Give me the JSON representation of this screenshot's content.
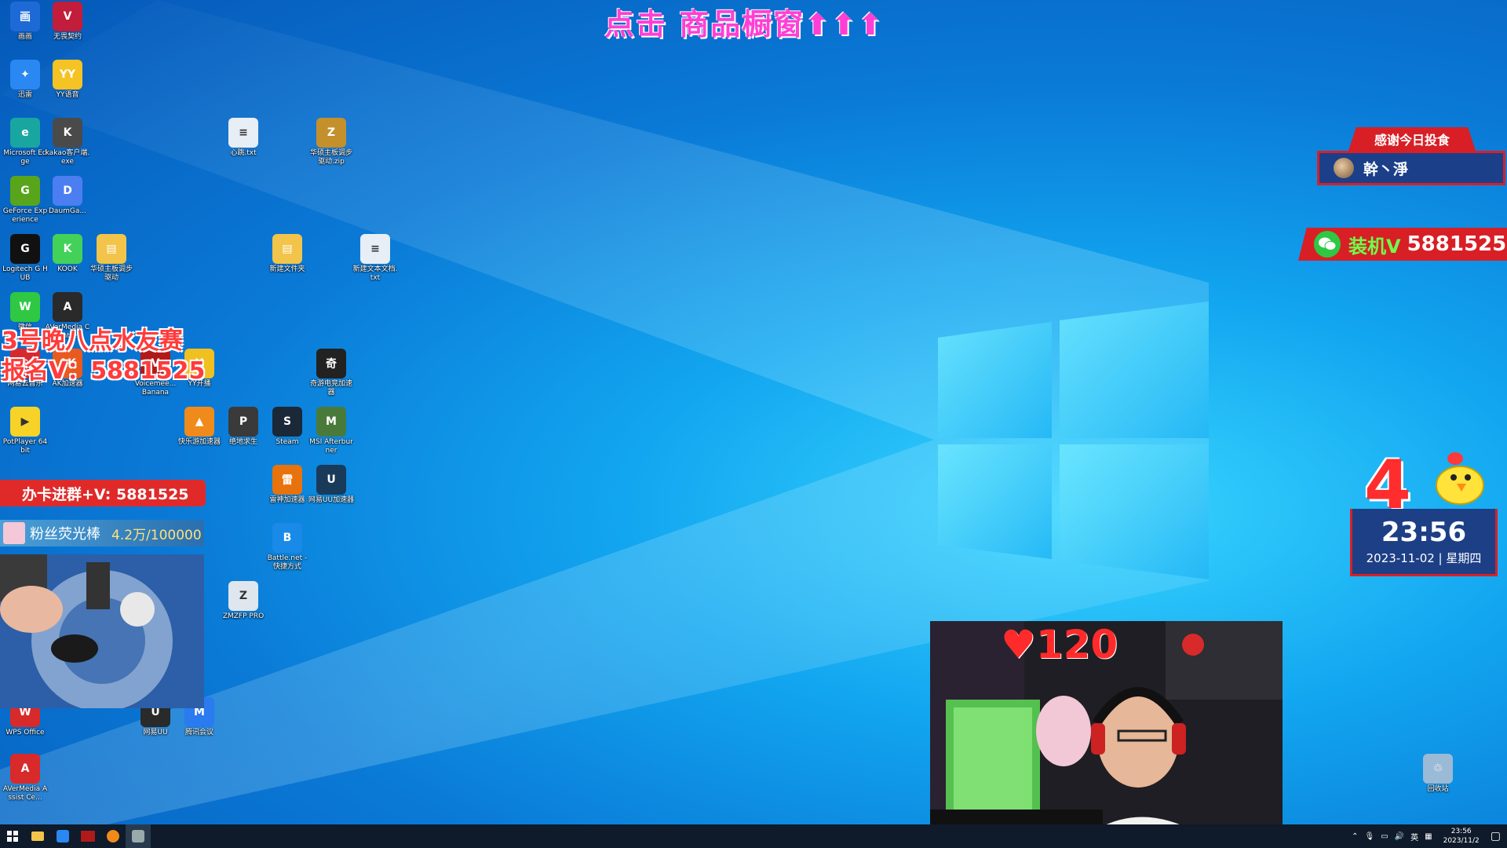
{
  "overlay": {
    "top_banner": "点击 商品橱窗⬆⬆⬆",
    "match_line1": "3号晚八点水友赛",
    "match_line2": "报名V：5881525",
    "group_bar": "办卡进群+V: 5881525",
    "fan_label": "粉丝荧光棒",
    "fan_count": "4.2万/100000",
    "thanks_title": "感谢今日投食",
    "thanks_user": "幹丶淨",
    "wechat_label": "装机V",
    "wechat_number": "5881525",
    "big_number": "4",
    "clock_time": "23:56",
    "clock_date": "2023-11-02 | 星期四",
    "heart_count": "120"
  },
  "desktop_icons": [
    {
      "label": "画画",
      "color": "#1d6ad6",
      "glyph": "画"
    },
    {
      "label": "无畏契约",
      "color": "#c21d3a",
      "glyph": "V"
    },
    {
      "label": "迅雷",
      "color": "#2a88f2",
      "glyph": "✦"
    },
    {
      "label": "YY语音",
      "color": "#f5c323",
      "glyph": "YY"
    },
    {
      "label": "Microsoft Edge",
      "color": "#1aa6a0",
      "glyph": "e"
    },
    {
      "label": "kakao客户端.exe",
      "color": "#4a4a4a",
      "glyph": "K"
    },
    {
      "label": "心跳.txt",
      "color": "#e8eef5",
      "glyph": "≡"
    },
    {
      "label": "华硕主板调步驱动.zip",
      "color": "#c4902c",
      "glyph": "Z"
    },
    {
      "label": "GeForce Experience",
      "color": "#58a51b",
      "glyph": "G"
    },
    {
      "label": "DaumGa...",
      "color": "#4b7ef0",
      "glyph": "D"
    },
    {
      "label": "Logitech G HUB",
      "color": "#111111",
      "glyph": "G"
    },
    {
      "label": "KOOK",
      "color": "#43d15a",
      "glyph": "K"
    },
    {
      "label": "华硕主板调步驱动",
      "color": "#f2c44a",
      "glyph": "▤"
    },
    {
      "label": "新建文件夹",
      "color": "#f2c44a",
      "glyph": "▤"
    },
    {
      "label": "新建文本文档.txt",
      "color": "#e8eef5",
      "glyph": "≡"
    },
    {
      "label": "微信",
      "color": "#2ec843",
      "glyph": "W"
    },
    {
      "label": "AVerMedia Centre",
      "color": "#2a2a2a",
      "glyph": "A"
    },
    {
      "label": "网易云音乐",
      "color": "#d8282f",
      "glyph": "♪"
    },
    {
      "label": "AK加速器",
      "color": "#e85a1f",
      "glyph": "AK"
    },
    {
      "label": "Voicemee... Banana",
      "color": "#b01a1a",
      "glyph": "V"
    },
    {
      "label": "YY开播",
      "color": "#f0c020",
      "glyph": "Y"
    },
    {
      "label": "奇游电竞加速器",
      "color": "#222222",
      "glyph": "奇"
    },
    {
      "label": "PotPlayer 64 bit",
      "color": "#f7d327",
      "glyph": "▶"
    },
    {
      "label": "快乐游加速器",
      "color": "#f08a1a",
      "glyph": "▲"
    },
    {
      "label": "绝地求生",
      "color": "#3a3a3a",
      "glyph": "P"
    },
    {
      "label": "Steam",
      "color": "#1b2838",
      "glyph": "S"
    },
    {
      "label": "MSI Afterburner",
      "color": "#4a7a3a",
      "glyph": "M"
    },
    {
      "label": "雷神加速器",
      "color": "#e8720c",
      "glyph": "雷"
    },
    {
      "label": "网易UU加速器",
      "color": "#1a3a5a",
      "glyph": "U"
    },
    {
      "label": "Battle.net - 快捷方式",
      "color": "#1a8ae8",
      "glyph": "B"
    },
    {
      "label": "ZMZFP PRO",
      "color": "#dfe6ee",
      "glyph": "Z"
    },
    {
      "label": "WPS Office",
      "color": "#d82a2a",
      "glyph": "W"
    },
    {
      "label": "网易UU",
      "color": "#2a2a2a",
      "glyph": "U"
    },
    {
      "label": "腾讯会议",
      "color": "#2a7af0",
      "glyph": "M"
    },
    {
      "label": "AVerMedia Assist Ce...",
      "color": "#d82a2a",
      "glyph": "A"
    },
    {
      "label": "回收站",
      "color": "#9bbad6",
      "glyph": "♲"
    }
  ],
  "taskbar": {
    "tray_lang": "英",
    "tray_time": "23:56",
    "tray_date": "2023/11/2"
  },
  "colors": {
    "accent_red": "#d81f26",
    "panel_blue": "#1d3f86",
    "banner_pink": "#ff3fd4"
  }
}
